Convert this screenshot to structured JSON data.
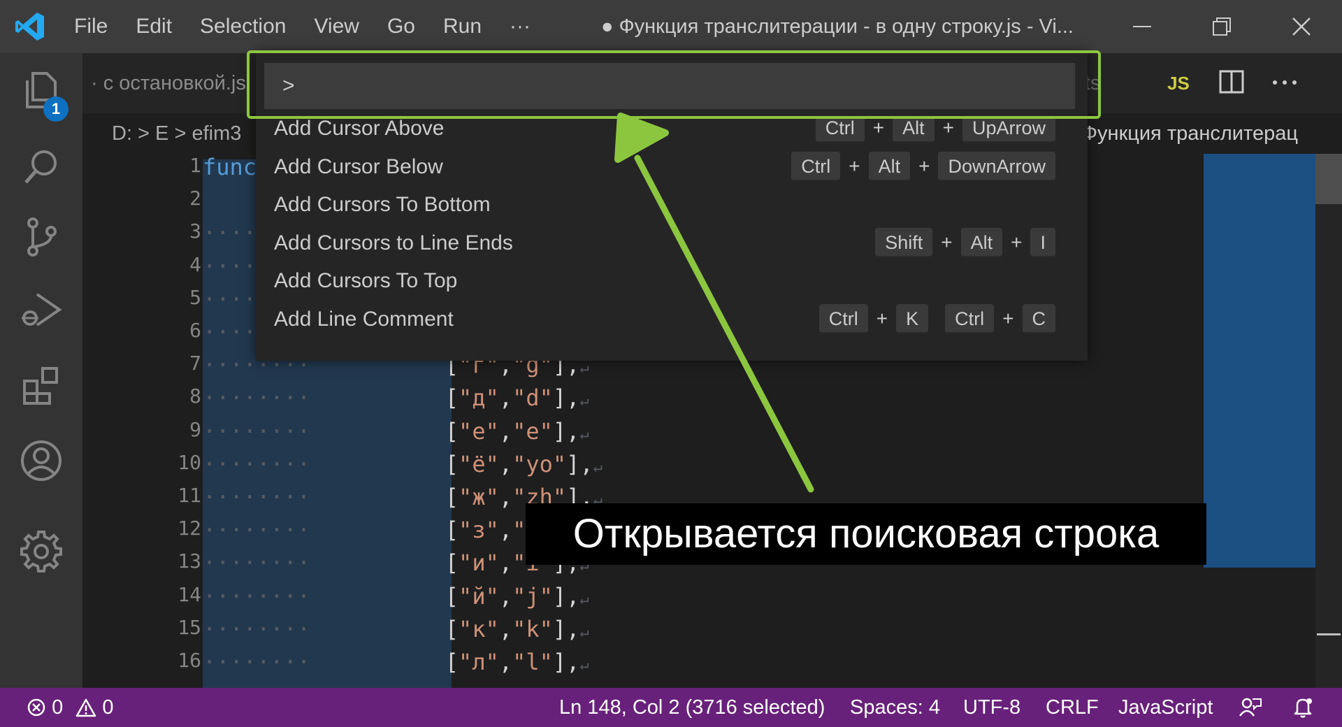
{
  "titlebar": {
    "menu": [
      "File",
      "Edit",
      "Selection",
      "View",
      "Go",
      "Run",
      "···"
    ],
    "title": "● Функция транслитерации - в одну строку.js - Vi..."
  },
  "activitybar": {
    "explorer_badge": "1"
  },
  "tabs": {
    "partial_left": "· с остановкой.js",
    "partial_right": "ts",
    "js_badge": "JS"
  },
  "breadcrumbs": {
    "left": "D: > E > efim3",
    "right": "Функция транслитерац"
  },
  "editor": {
    "line_numbers": [
      "1",
      "2",
      "3",
      "4",
      "5",
      "6",
      "7",
      "8",
      "9",
      "10",
      "11",
      "12",
      "13",
      "14",
      "15",
      "16"
    ],
    "first_line_text": "func",
    "pairs": [
      {
        "line": 7,
        "a": "г",
        "b": "g"
      },
      {
        "line": 8,
        "a": "д",
        "b": "d"
      },
      {
        "line": 9,
        "a": "е",
        "b": "e"
      },
      {
        "line": 10,
        "a": "ё",
        "b": "yo"
      },
      {
        "line": 11,
        "a": "ж",
        "b": "zh"
      },
      {
        "line": 12,
        "a": "з",
        "b": "z"
      },
      {
        "line": 13,
        "a": "и",
        "b": "i"
      },
      {
        "line": 14,
        "a": "й",
        "b": "j"
      },
      {
        "line": 15,
        "a": "к",
        "b": "k"
      },
      {
        "line": 16,
        "a": "л",
        "b": "l"
      }
    ]
  },
  "command_palette": {
    "input_value": ">",
    "items": [
      {
        "label": "Add Cursor Above",
        "keys": [
          [
            "Ctrl",
            "Alt",
            "UpArrow"
          ]
        ]
      },
      {
        "label": "Add Cursor Below",
        "keys": [
          [
            "Ctrl",
            "Alt",
            "DownArrow"
          ]
        ]
      },
      {
        "label": "Add Cursors To Bottom",
        "keys": []
      },
      {
        "label": "Add Cursors to Line Ends",
        "keys": [
          [
            "Shift",
            "Alt",
            "I"
          ]
        ]
      },
      {
        "label": "Add Cursors To Top",
        "keys": []
      },
      {
        "label": "Add Line Comment",
        "keys": [
          [
            "Ctrl",
            "K"
          ],
          [
            "Ctrl",
            "C"
          ]
        ]
      }
    ]
  },
  "caption": "Открывается поисковая строка",
  "statusbar": {
    "errors": "0",
    "warnings": "0",
    "position": "Ln 148, Col 2 (3716 selected)",
    "spaces": "Spaces: 4",
    "encoding": "UTF-8",
    "eol": "CRLF",
    "language": "JavaScript"
  },
  "colors": {
    "statusbar_bg": "#68217a",
    "highlight_border": "#8cc63f",
    "badge": "#0e70c0",
    "vscode_blue": "#23a9f2"
  }
}
